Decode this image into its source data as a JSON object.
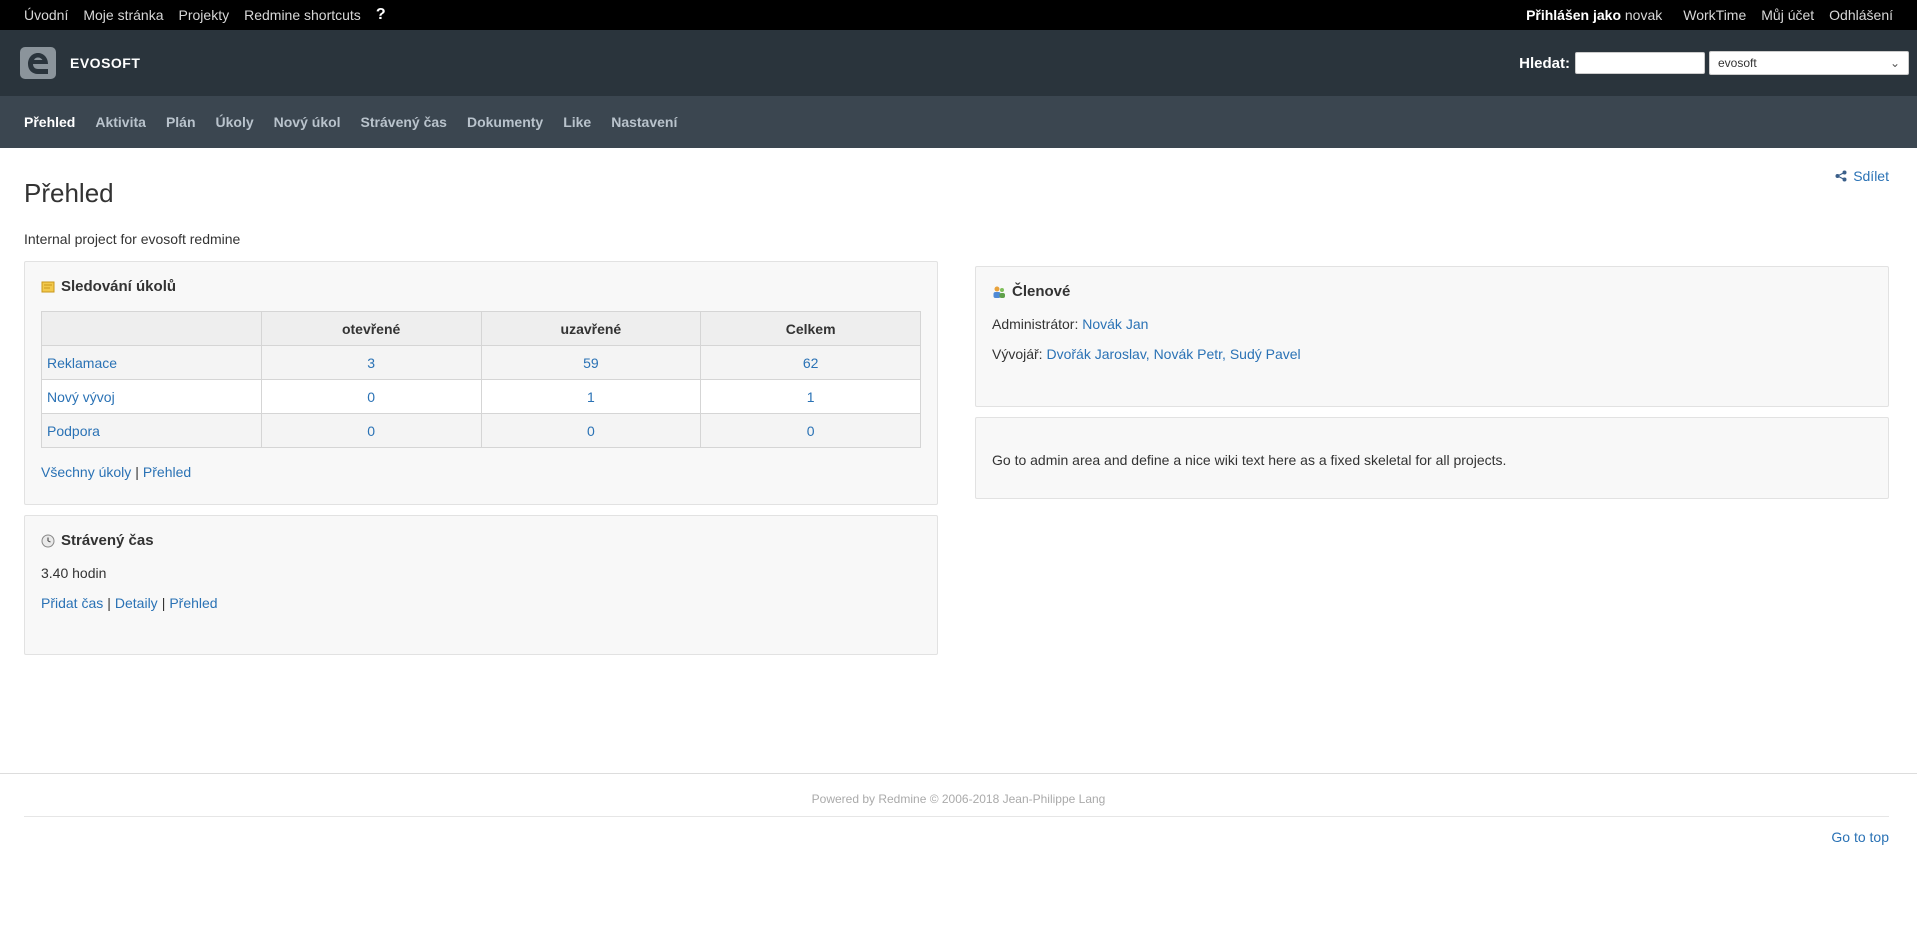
{
  "topbar": {
    "left": [
      "Úvodní",
      "Moje stránka",
      "Projekty",
      "Redmine shortcuts"
    ],
    "help": "?",
    "logged_label": "Přihlášen jako",
    "logged_user": "novak",
    "right": [
      "WorkTime",
      "Můj účet",
      "Odhlášení"
    ]
  },
  "header": {
    "brand": "EVOSOFT",
    "search_label": "Hledat:",
    "search_value": "",
    "project_select": "evosoft"
  },
  "nav": {
    "tabs": [
      "Přehled",
      "Aktivita",
      "Plán",
      "Úkoly",
      "Nový úkol",
      "Strávený čas",
      "Dokumenty",
      "Like",
      "Nastavení"
    ],
    "active": "Přehled"
  },
  "page": {
    "title": "Přehled",
    "share": "Sdílet",
    "description": "Internal project for evosoft redmine"
  },
  "issues_box": {
    "title": "Sledování úkolů",
    "headers": [
      "",
      "otevřené",
      "uzavřené",
      "Celkem"
    ],
    "rows": [
      {
        "name": "Reklamace",
        "open": "3",
        "closed": "59",
        "total": "62"
      },
      {
        "name": "Nový vývoj",
        "open": "0",
        "closed": "1",
        "total": "1"
      },
      {
        "name": "Podpora",
        "open": "0",
        "closed": "0",
        "total": "0"
      }
    ],
    "links": [
      "Všechny úkoly",
      "Přehled"
    ]
  },
  "time_box": {
    "title": "Strávený čas",
    "value": "3.40 hodin",
    "links": [
      "Přidat čas",
      "Detaily",
      "Přehled"
    ]
  },
  "members_box": {
    "title": "Členové",
    "admin_label": "Administrátor:",
    "admin": "Novák Jan",
    "dev_label": "Vývojář:",
    "devs": "Dvořák Jaroslav, Novák Petr, Sudý Pavel"
  },
  "wiki_box": {
    "text": "Go to admin area and define a nice wiki text here as a fixed skeletal for all projects."
  },
  "go_top": "Go to top",
  "footer": {
    "text_pre": "Powered by ",
    "link": "Redmine",
    "text_post": " © 2006-2018 Jean-Philippe Lang"
  },
  "colors": {
    "topbar": "#000000",
    "header": "#2a343c",
    "nav": "#3b4650",
    "link": "#2a72b5"
  }
}
